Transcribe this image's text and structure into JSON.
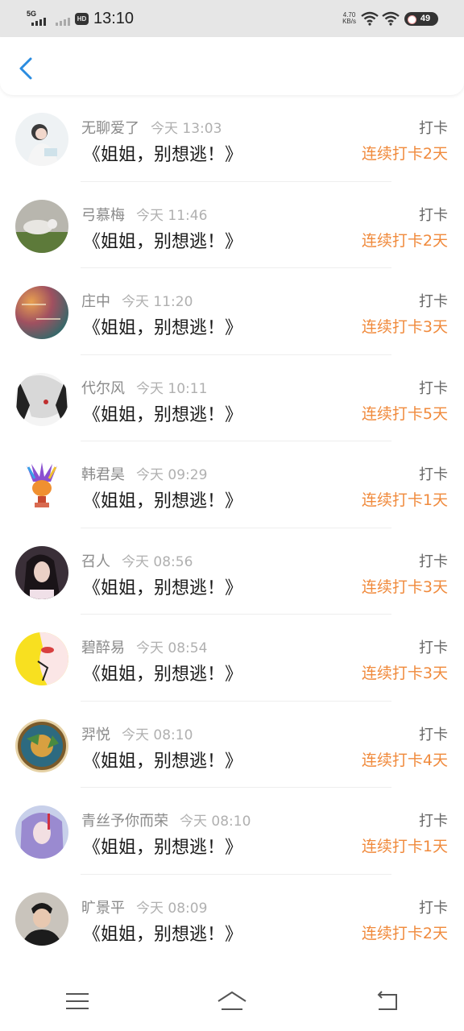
{
  "status_bar": {
    "network": "5G",
    "hd": "HD",
    "time": "13:10",
    "net_speed_value": "4.70",
    "net_speed_unit": "KB/s",
    "battery": "49"
  },
  "header": {
    "back_icon": "chevron-left-icon",
    "accent_color": "#2a8ce0"
  },
  "colors": {
    "streak": "#f08a3c",
    "name": "#8a8a8a",
    "time": "#b0b0b0",
    "title": "#1a1a1a"
  },
  "items": [
    {
      "name": "无聊爱了",
      "time": "今天 13:03",
      "title": "《姐姐，别想逃！》",
      "tag": "打卡",
      "streak": "连续打卡2天"
    },
    {
      "name": "弓慕梅",
      "time": "今天 11:46",
      "title": "《姐姐，别想逃！》",
      "tag": "打卡",
      "streak": "连续打卡2天"
    },
    {
      "name": "庄中",
      "time": "今天 11:20",
      "title": "《姐姐，别想逃！》",
      "tag": "打卡",
      "streak": "连续打卡3天"
    },
    {
      "name": "代尔风",
      "time": "今天 10:11",
      "title": "《姐姐，别想逃！》",
      "tag": "打卡",
      "streak": "连续打卡5天"
    },
    {
      "name": "韩君昊",
      "time": "今天 09:29",
      "title": "《姐姐，别想逃！》",
      "tag": "打卡",
      "streak": "连续打卡1天"
    },
    {
      "name": "召人",
      "time": "今天 08:56",
      "title": "《姐姐，别想逃！》",
      "tag": "打卡",
      "streak": "连续打卡3天"
    },
    {
      "name": "碧醉易",
      "time": "今天 08:54",
      "title": "《姐姐，别想逃！》",
      "tag": "打卡",
      "streak": "连续打卡3天"
    },
    {
      "name": "羿悦",
      "time": "今天 08:10",
      "title": "《姐姐，别想逃！》",
      "tag": "打卡",
      "streak": "连续打卡4天"
    },
    {
      "name": "青丝予你而荣",
      "time": "今天 08:10",
      "title": "《姐姐，别想逃！》",
      "tag": "打卡",
      "streak": "连续打卡1天"
    },
    {
      "name": "旷景平",
      "time": "今天 08:09",
      "title": "《姐姐，别想逃！》",
      "tag": "打卡",
      "streak": "连续打卡2天"
    }
  ],
  "nav": {
    "menu_icon": "menu-icon",
    "home_icon": "home-icon",
    "back_icon": "back-icon"
  }
}
